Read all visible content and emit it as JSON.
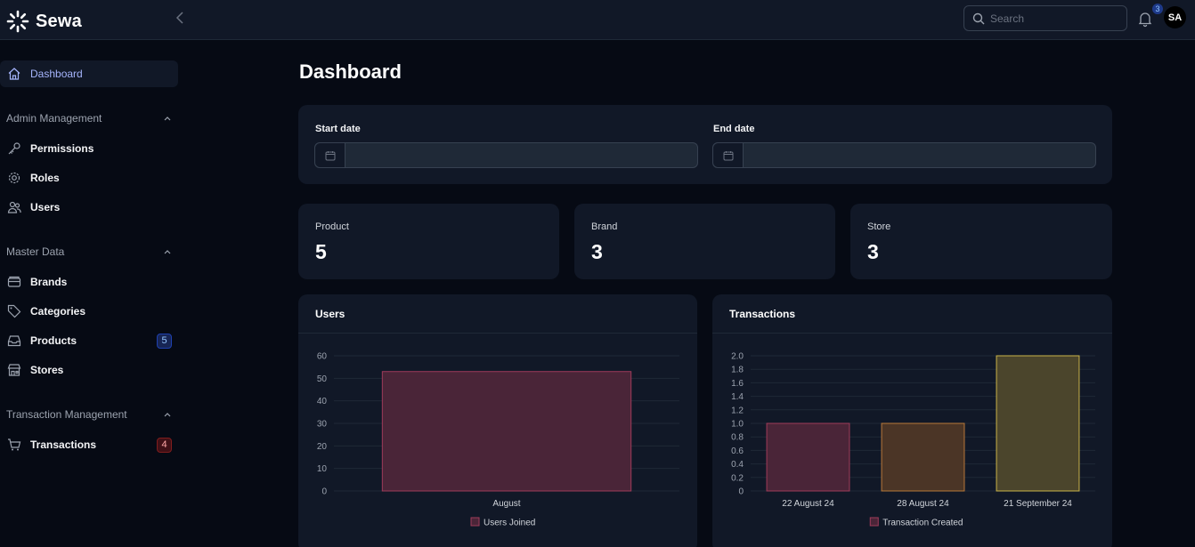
{
  "app": {
    "brand": "Sewa"
  },
  "header": {
    "search_placeholder": "Search",
    "notification_count": "3",
    "avatar_initials": "SA"
  },
  "sidebar": {
    "dashboard": "Dashboard",
    "groups": {
      "admin": "Admin Management",
      "master": "Master Data",
      "transaction": "Transaction Management"
    },
    "items": {
      "permissions": "Permissions",
      "roles": "Roles",
      "users": "Users",
      "brands": "Brands",
      "categories": "Categories",
      "products": "Products",
      "products_badge": "5",
      "stores": "Stores",
      "transactions": "Transactions",
      "transactions_badge": "4"
    }
  },
  "main": {
    "title": "Dashboard",
    "filters": {
      "start_label": "Start date",
      "end_label": "End date",
      "start_value": "",
      "end_value": ""
    },
    "stats": [
      {
        "label": "Product",
        "value": "5"
      },
      {
        "label": "Brand",
        "value": "3"
      },
      {
        "label": "Store",
        "value": "3"
      }
    ]
  },
  "chart_data": [
    {
      "type": "bar",
      "title": "Users",
      "categories": [
        "August"
      ],
      "series": [
        {
          "name": "Users Joined",
          "values": [
            53
          ],
          "fill": "#4a2538",
          "stroke": "#9f3b5a"
        }
      ],
      "ylim": [
        0,
        60
      ],
      "yticks": [
        "0",
        "10",
        "20",
        "30",
        "40",
        "50",
        "60"
      ],
      "grid": true,
      "legend": "bottom"
    },
    {
      "type": "bar",
      "title": "Transactions",
      "categories": [
        "22 August 24",
        "28 August 24",
        "21 September 24"
      ],
      "series": [
        {
          "name": "Transaction Created",
          "values": [
            1,
            1,
            2
          ],
          "fills": [
            "#4a2538",
            "#4b3526",
            "#4b452c"
          ],
          "strokes": [
            "#9f3b5a",
            "#b7793a",
            "#c9b44a"
          ]
        }
      ],
      "ylim": [
        0,
        2
      ],
      "yticks": [
        "0",
        "0.2",
        "0.4",
        "0.6",
        "0.8",
        "1.0",
        "1.2",
        "1.4",
        "1.6",
        "1.8",
        "2.0"
      ],
      "grid": true,
      "legend": "bottom"
    }
  ]
}
